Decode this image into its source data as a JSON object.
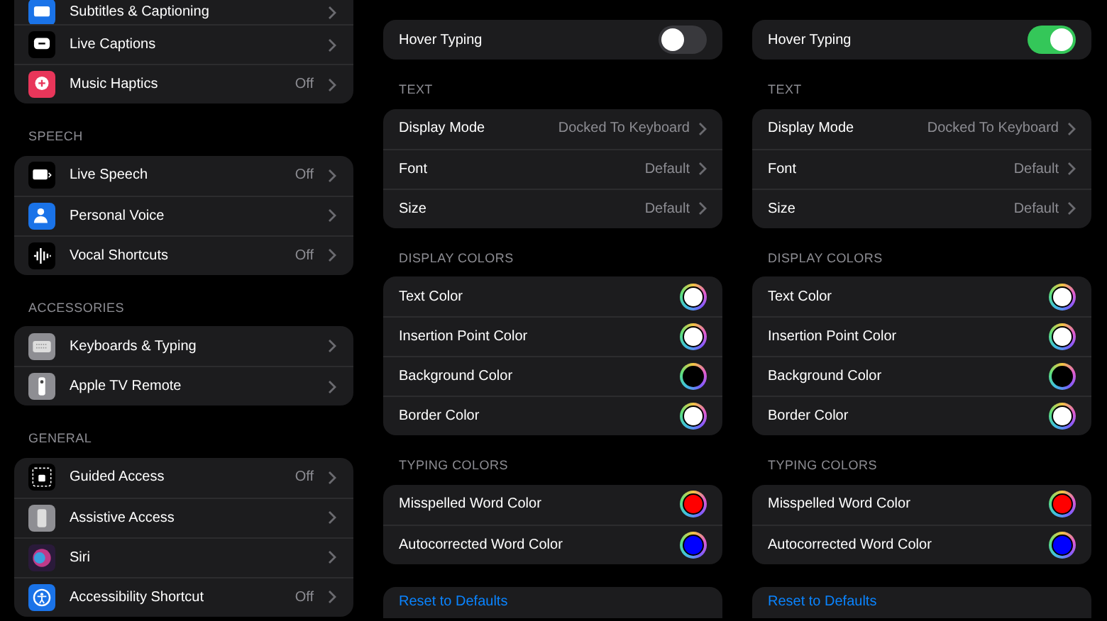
{
  "sidebar": {
    "sections": [
      {
        "items": [
          {
            "label": "Subtitles & Captioning"
          },
          {
            "label": "Live Captions"
          },
          {
            "label": "Music Haptics",
            "value": "Off"
          }
        ]
      },
      {
        "header": "SPEECH",
        "items": [
          {
            "label": "Live Speech",
            "value": "Off"
          },
          {
            "label": "Personal Voice"
          },
          {
            "label": "Vocal Shortcuts",
            "value": "Off"
          }
        ]
      },
      {
        "header": "ACCESSORIES",
        "items": [
          {
            "label": "Keyboards & Typing"
          },
          {
            "label": "Apple TV Remote"
          }
        ]
      },
      {
        "header": "GENERAL",
        "items": [
          {
            "label": "Guided Access",
            "value": "Off"
          },
          {
            "label": "Assistive Access"
          },
          {
            "label": "Siri"
          },
          {
            "label": "Accessibility Shortcut",
            "value": "Off"
          }
        ]
      }
    ]
  },
  "panels": [
    {
      "hover_typing": {
        "label": "Hover Typing",
        "on": false
      },
      "sections": [
        {
          "header": "TEXT",
          "items": [
            {
              "kind": "link",
              "label": "Display Mode",
              "value": "Docked To Keyboard"
            },
            {
              "kind": "link",
              "label": "Font",
              "value": "Default"
            },
            {
              "kind": "link",
              "label": "Size",
              "value": "Default"
            }
          ]
        },
        {
          "header": "DISPLAY COLORS",
          "items": [
            {
              "kind": "swatch",
              "label": "Text Color",
              "color": "#ffffff"
            },
            {
              "kind": "swatch",
              "label": "Insertion Point Color",
              "color": "#ffffff"
            },
            {
              "kind": "swatch",
              "label": "Background Color",
              "color": "#000000"
            },
            {
              "kind": "swatch",
              "label": "Border Color",
              "color": "#ffffff"
            }
          ]
        },
        {
          "header": "TYPING COLORS",
          "items": [
            {
              "kind": "swatch",
              "label": "Misspelled Word Color",
              "color": "#ff0000"
            },
            {
              "kind": "swatch",
              "label": "Autocorrected Word Color",
              "color": "#0000ff"
            }
          ]
        }
      ],
      "reset": "Reset to Defaults"
    },
    {
      "hover_typing": {
        "label": "Hover Typing",
        "on": true
      },
      "sections": [
        {
          "header": "TEXT",
          "items": [
            {
              "kind": "link",
              "label": "Display Mode",
              "value": "Docked To Keyboard"
            },
            {
              "kind": "link",
              "label": "Font",
              "value": "Default"
            },
            {
              "kind": "link",
              "label": "Size",
              "value": "Default"
            }
          ]
        },
        {
          "header": "DISPLAY COLORS",
          "items": [
            {
              "kind": "swatch",
              "label": "Text Color",
              "color": "#ffffff"
            },
            {
              "kind": "swatch",
              "label": "Insertion Point Color",
              "color": "#ffffff"
            },
            {
              "kind": "swatch",
              "label": "Background Color",
              "color": "#000000"
            },
            {
              "kind": "swatch",
              "label": "Border Color",
              "color": "#ffffff"
            }
          ]
        },
        {
          "header": "TYPING COLORS",
          "items": [
            {
              "kind": "swatch",
              "label": "Misspelled Word Color",
              "color": "#ff0000"
            },
            {
              "kind": "swatch",
              "label": "Autocorrected Word Color",
              "color": "#0000ff"
            }
          ]
        }
      ],
      "reset": "Reset to Defaults"
    }
  ]
}
